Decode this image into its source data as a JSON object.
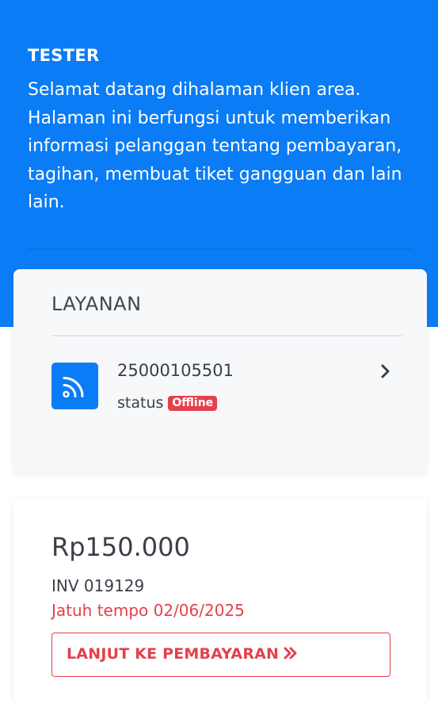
{
  "hero": {
    "user_name": "TESTER",
    "welcome_text": "Selamat datang dihalaman klien area. Halaman ini berfungsi untuk memberikan informasi pelanggan tentang pembayaran, tagihan, membuat tiket gangguan dan lain lain."
  },
  "services": {
    "title": "LAYANAN",
    "items": [
      {
        "id": "25000105501",
        "status_label": "status",
        "status_value": "Offline",
        "icon": "rss-icon"
      }
    ]
  },
  "invoice": {
    "amount": "Rp150.000",
    "number": "INV 019129",
    "due_date": "Jatuh tempo 02/06/2025",
    "pay_button_label": "LANJUT KE PEMBAYARAN",
    "pay_button_icon": "double-chevron-right-icon"
  },
  "colors": {
    "primary": "#0a7cf5",
    "danger": "#e5404b",
    "text": "#3a3f47"
  }
}
